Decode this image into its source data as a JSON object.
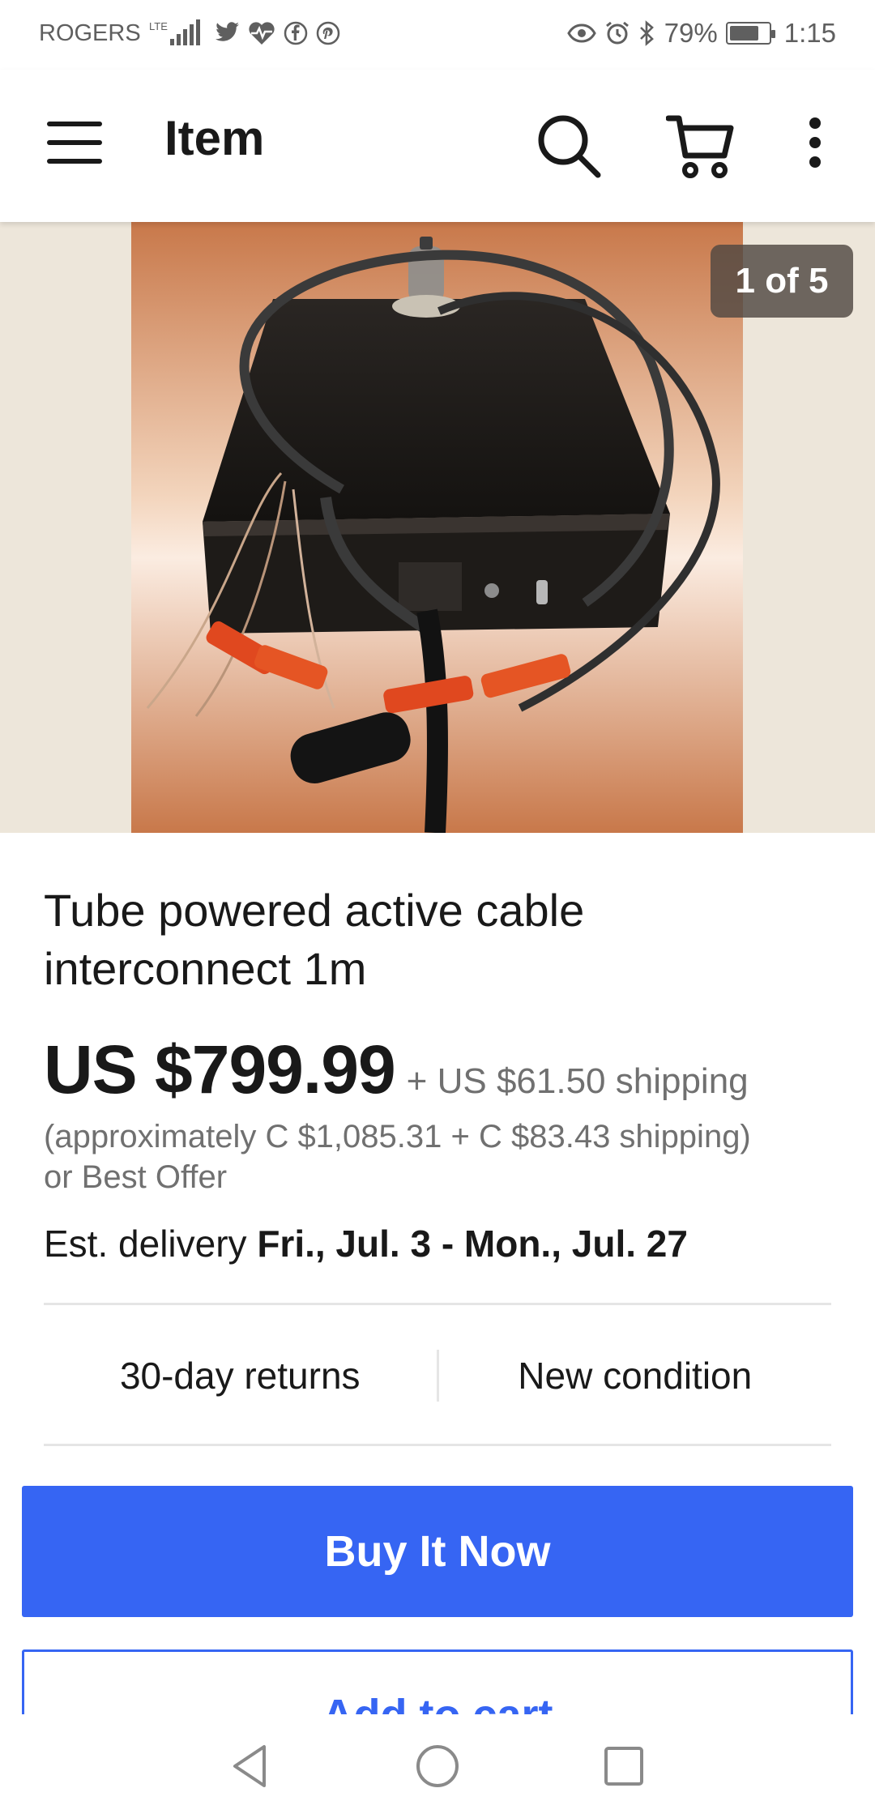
{
  "status_bar": {
    "carrier": "ROGERS",
    "network": "LTE",
    "battery": "79%",
    "battery_level": 0.79,
    "time": "1:15"
  },
  "app_bar": {
    "title": "Item",
    "icons": [
      "hamburger-menu-icon",
      "search-icon",
      "cart-icon",
      "more-vertical-icon"
    ]
  },
  "gallery": {
    "counter": "1 of 5",
    "image_description_icon": "product-photo"
  },
  "listing": {
    "title": "Tube powered active cable interconnect 1m",
    "price": "US $799.99",
    "shipping": "+ US $61.50 shipping",
    "approx_line1": "(approximately C $1,085.31 + C $83.43 shipping)",
    "approx_line2": "or Best Offer",
    "delivery_prefix": "Est. delivery ",
    "delivery_dates": "Fri., Jul. 3 - Mon., Jul. 27"
  },
  "features": {
    "returns": "30-day returns",
    "condition": "New condition"
  },
  "actions": {
    "buy_now": "Buy It Now",
    "add_to_cart": "Add to cart"
  },
  "colors": {
    "primary": "#3665f3",
    "gallery_bg": "#ede6da"
  }
}
